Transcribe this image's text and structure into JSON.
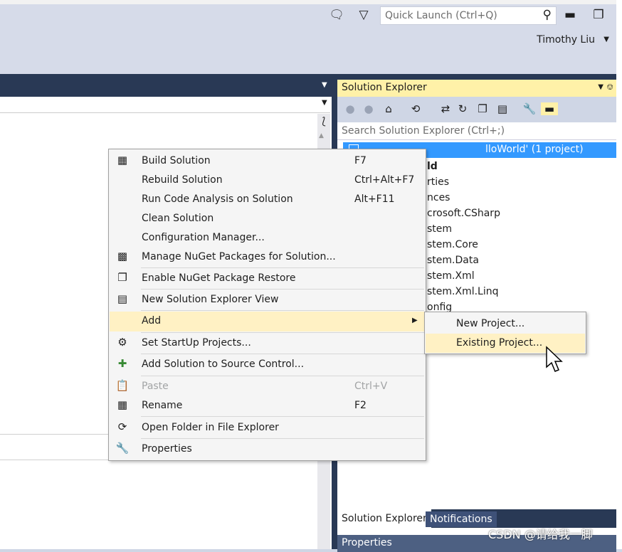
{
  "titlebar": {
    "quick_launch_placeholder": "Quick Launch (Ctrl+Q)",
    "user_name": "Timothy Liu",
    "icons": [
      "feedback-icon",
      "filter-icon",
      "search-icon",
      "minimize-icon",
      "restore-icon"
    ]
  },
  "solution_explorer": {
    "title": "Solution Explorer",
    "search_placeholder": "Search Solution Explorer (Ctrl+;)",
    "selected_item": "lloWorld' (1 project)",
    "items": [
      "ld",
      "rties",
      "nces",
      "crosoft.CSharp",
      "stem",
      "stem.Core",
      "stem.Data",
      "stem.Xml",
      "stem.Xml.Linq",
      "onfig"
    ],
    "tabs": [
      "Solution Explorer",
      "Notifications"
    ],
    "properties_label": "Properties"
  },
  "context_menu": {
    "items": [
      {
        "label": "Build Solution",
        "shortcut": "F7",
        "icon": "build-icon"
      },
      {
        "label": "Rebuild Solution",
        "shortcut": "Ctrl+Alt+F7",
        "icon": ""
      },
      {
        "label": "Run Code Analysis on Solution",
        "shortcut": "Alt+F11",
        "icon": ""
      },
      {
        "label": "Clean Solution",
        "shortcut": "",
        "icon": ""
      },
      {
        "label": "Configuration Manager...",
        "shortcut": "",
        "icon": ""
      },
      {
        "label": "Manage NuGet Packages for Solution...",
        "shortcut": "",
        "icon": "nuget-icon"
      },
      {
        "label": "Enable NuGet Package Restore",
        "shortcut": "",
        "icon": "restore-package-icon"
      },
      {
        "label": "New Solution Explorer View",
        "shortcut": "",
        "icon": "new-view-icon"
      },
      {
        "label": "Add",
        "shortcut": "",
        "icon": ""
      },
      {
        "label": "Set StartUp Projects...",
        "shortcut": "",
        "icon": "gear-icon"
      },
      {
        "label": "Add Solution to Source Control...",
        "shortcut": "",
        "icon": "source-control-icon"
      },
      {
        "label": "Paste",
        "shortcut": "Ctrl+V",
        "icon": "paste-icon"
      },
      {
        "label": "Rename",
        "shortcut": "F2",
        "icon": "rename-icon"
      },
      {
        "label": "Open Folder in File Explorer",
        "shortcut": "",
        "icon": "open-folder-icon"
      },
      {
        "label": "Properties",
        "shortcut": "",
        "icon": "wrench-icon"
      }
    ]
  },
  "submenu": {
    "items": [
      "New Project...",
      "Existing Project..."
    ]
  },
  "watermark": "CSDN @请给我一脚"
}
